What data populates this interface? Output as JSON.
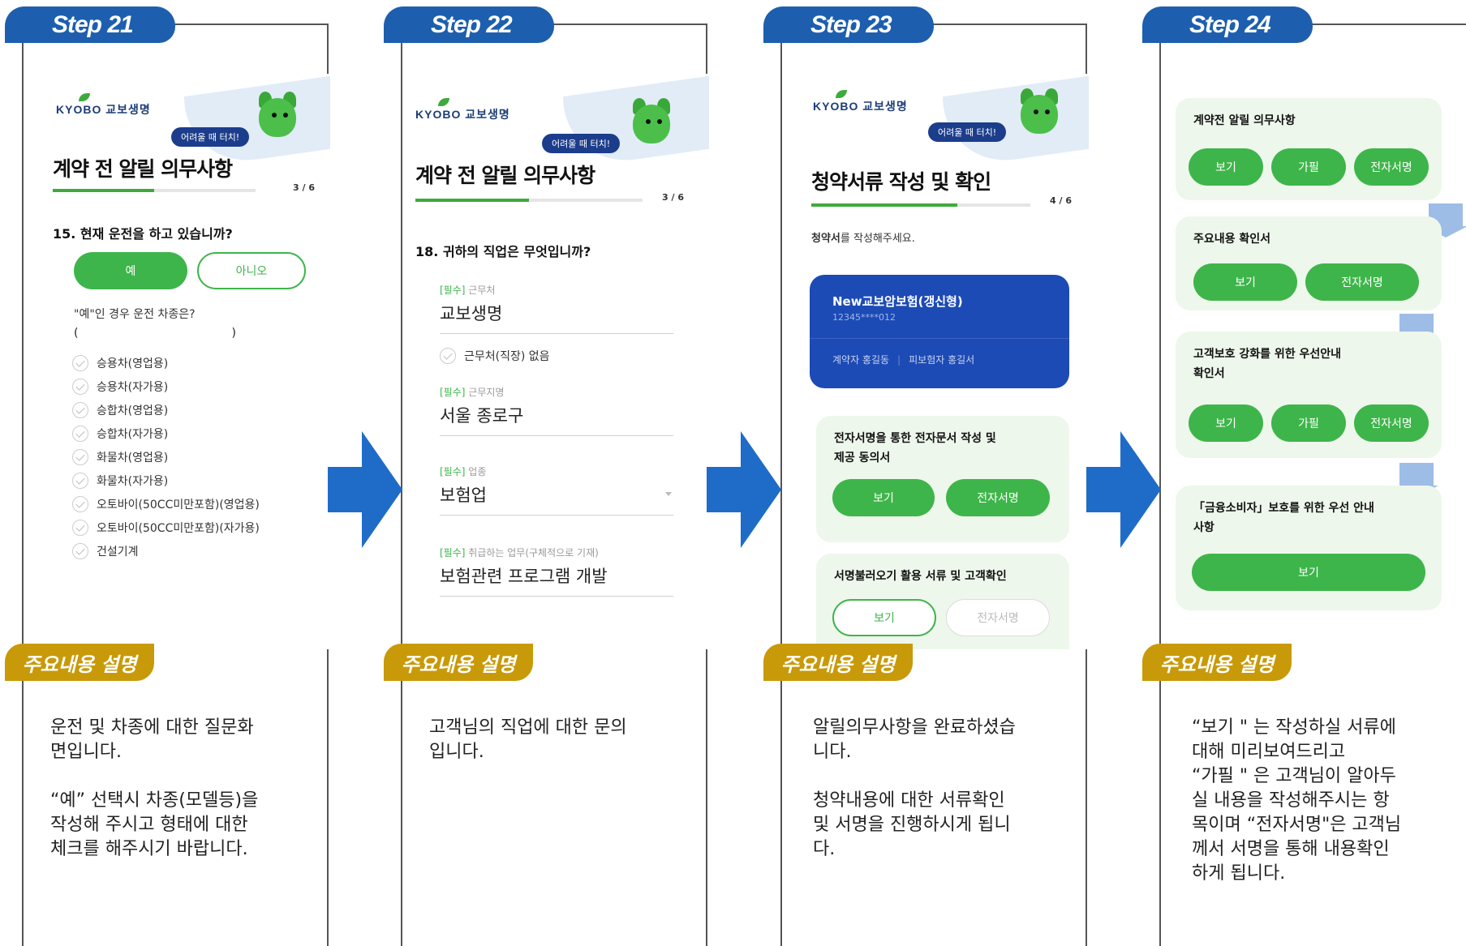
{
  "steps": [
    {
      "tab": "Step 21",
      "screen": {
        "logo": "KYOBO 교보생명",
        "help": "어려울 때 터치!",
        "title": "계약 전 알릴 의무사항",
        "progress": "3 / 6",
        "progress_fraction": 0.5,
        "question": "15. 현재 운전을 하고 있습니까?",
        "yes": "예",
        "no": "아니오",
        "sub_question": "\"예\"인 경우 운전 차종은?",
        "bracket_open": "(",
        "bracket_close": ")",
        "options": [
          "승용차(영업용)",
          "승용차(자가용)",
          "승합차(영업용)",
          "승합차(자가용)",
          "화물차(영업용)",
          "화물차(자가용)",
          "오토바이(50CC미만포함)(영업용)",
          "오토바이(50CC미만포함)(자가용)",
          "건설기계"
        ]
      },
      "desc_tag": "주요내용 설명",
      "desc": [
        "운전 및 차종에 대한 질문화\n면입니다.",
        "“예” 선택시 차종(모델등)을\n작성해 주시고 형태에 대한\n체크를 해주시기 바랍니다."
      ]
    },
    {
      "tab": "Step 22",
      "screen": {
        "logo": "KYOBO 교보생명",
        "help": "어려울 때 터치!",
        "title": "계약 전 알릴 의무사항",
        "progress": "3 / 6",
        "progress_fraction": 0.5,
        "question": "18. 귀하의 직업은 무엇입니까?",
        "fields": [
          {
            "req": "[필수]",
            "label": "근무처",
            "value": "교보생명"
          },
          {
            "req": "[필수]",
            "label": "근무지명",
            "value": "서울 종로구"
          },
          {
            "req": "[필수]",
            "label": "업종",
            "value": "보험업"
          },
          {
            "req": "[필수]",
            "label": "취급하는 업무(구체적으로 기재)",
            "value": "보험관련 프로그램 개발"
          }
        ],
        "no_workplace": "근무처(직장) 없음"
      },
      "desc_tag": "주요내용 설명",
      "desc": [
        "고객님의 직업에 대한 문의\n입니다."
      ]
    },
    {
      "tab": "Step 23",
      "screen": {
        "logo": "KYOBO 교보생명",
        "help": "어려울 때 터치!",
        "title": "청약서류 작성 및 확인",
        "progress": "4 / 6",
        "progress_fraction": 0.6667,
        "instruction_bold": "청약서",
        "instruction_rest": "를 작성해주세요.",
        "product": "New교보암보험(갱신형)",
        "policy_no": "12345****012",
        "contractor": "계약자 홍길동",
        "insured": "피보험자 홍길서",
        "card1_title": "전자서명을 통한 전자문서 작성 및\n제공 동의서",
        "card1_view": "보기",
        "card1_sign": "전자서명",
        "card2_title": "서명불러오기 활용 서류 및 고객확인",
        "card2_view": "보기",
        "card2_sign": "전자서명"
      },
      "desc_tag": "주요내용 설명",
      "desc": [
        "알릴의무사항을 완료하셨습\n니다.",
        "청약내용에 대한 서류확인\n및 서명을 진행하시게 됩니\n다."
      ]
    },
    {
      "tab": "Step 24",
      "screen": {
        "cards": [
          {
            "title": "계약전 알릴 의무사항",
            "buttons": [
              "보기",
              "가필",
              "전자서명"
            ]
          },
          {
            "title": "주요내용 확인서",
            "buttons": [
              "보기",
              "전자서명"
            ]
          },
          {
            "title": "고객보호 강화를 위한 우선안내\n확인서",
            "buttons": [
              "보기",
              "가필",
              "전자서명"
            ]
          },
          {
            "title": "「금융소비자」보호를 위한 우선 안내\n사항",
            "buttons": [
              "보기"
            ]
          }
        ]
      },
      "desc_tag": "주요내용 설명",
      "desc": [
        "“보기 \" 는 작성하실 서류에\n대해 미리보여드리고\n“가필 \" 은 고객님이 알아두\n실 내용을 작성해주시는 항\n목이며 “전자서명\"은 고객님\n께서 서명을 통해 내용확인\n하게 됩니다."
      ]
    }
  ],
  "colors": {
    "step_tab": "#1d5fae",
    "desc_tag": "#c89a09",
    "arrow": "#1f6cc8",
    "green": "#3eb54a",
    "card_bg": "#eef7ec",
    "product_card": "#1d4bb5"
  },
  "icons": [
    "right-arrow-icon",
    "check-circle-icon",
    "leaf-logo-icon",
    "mascot-icon",
    "down-arrow-icon",
    "dropdown-caret-icon"
  ]
}
